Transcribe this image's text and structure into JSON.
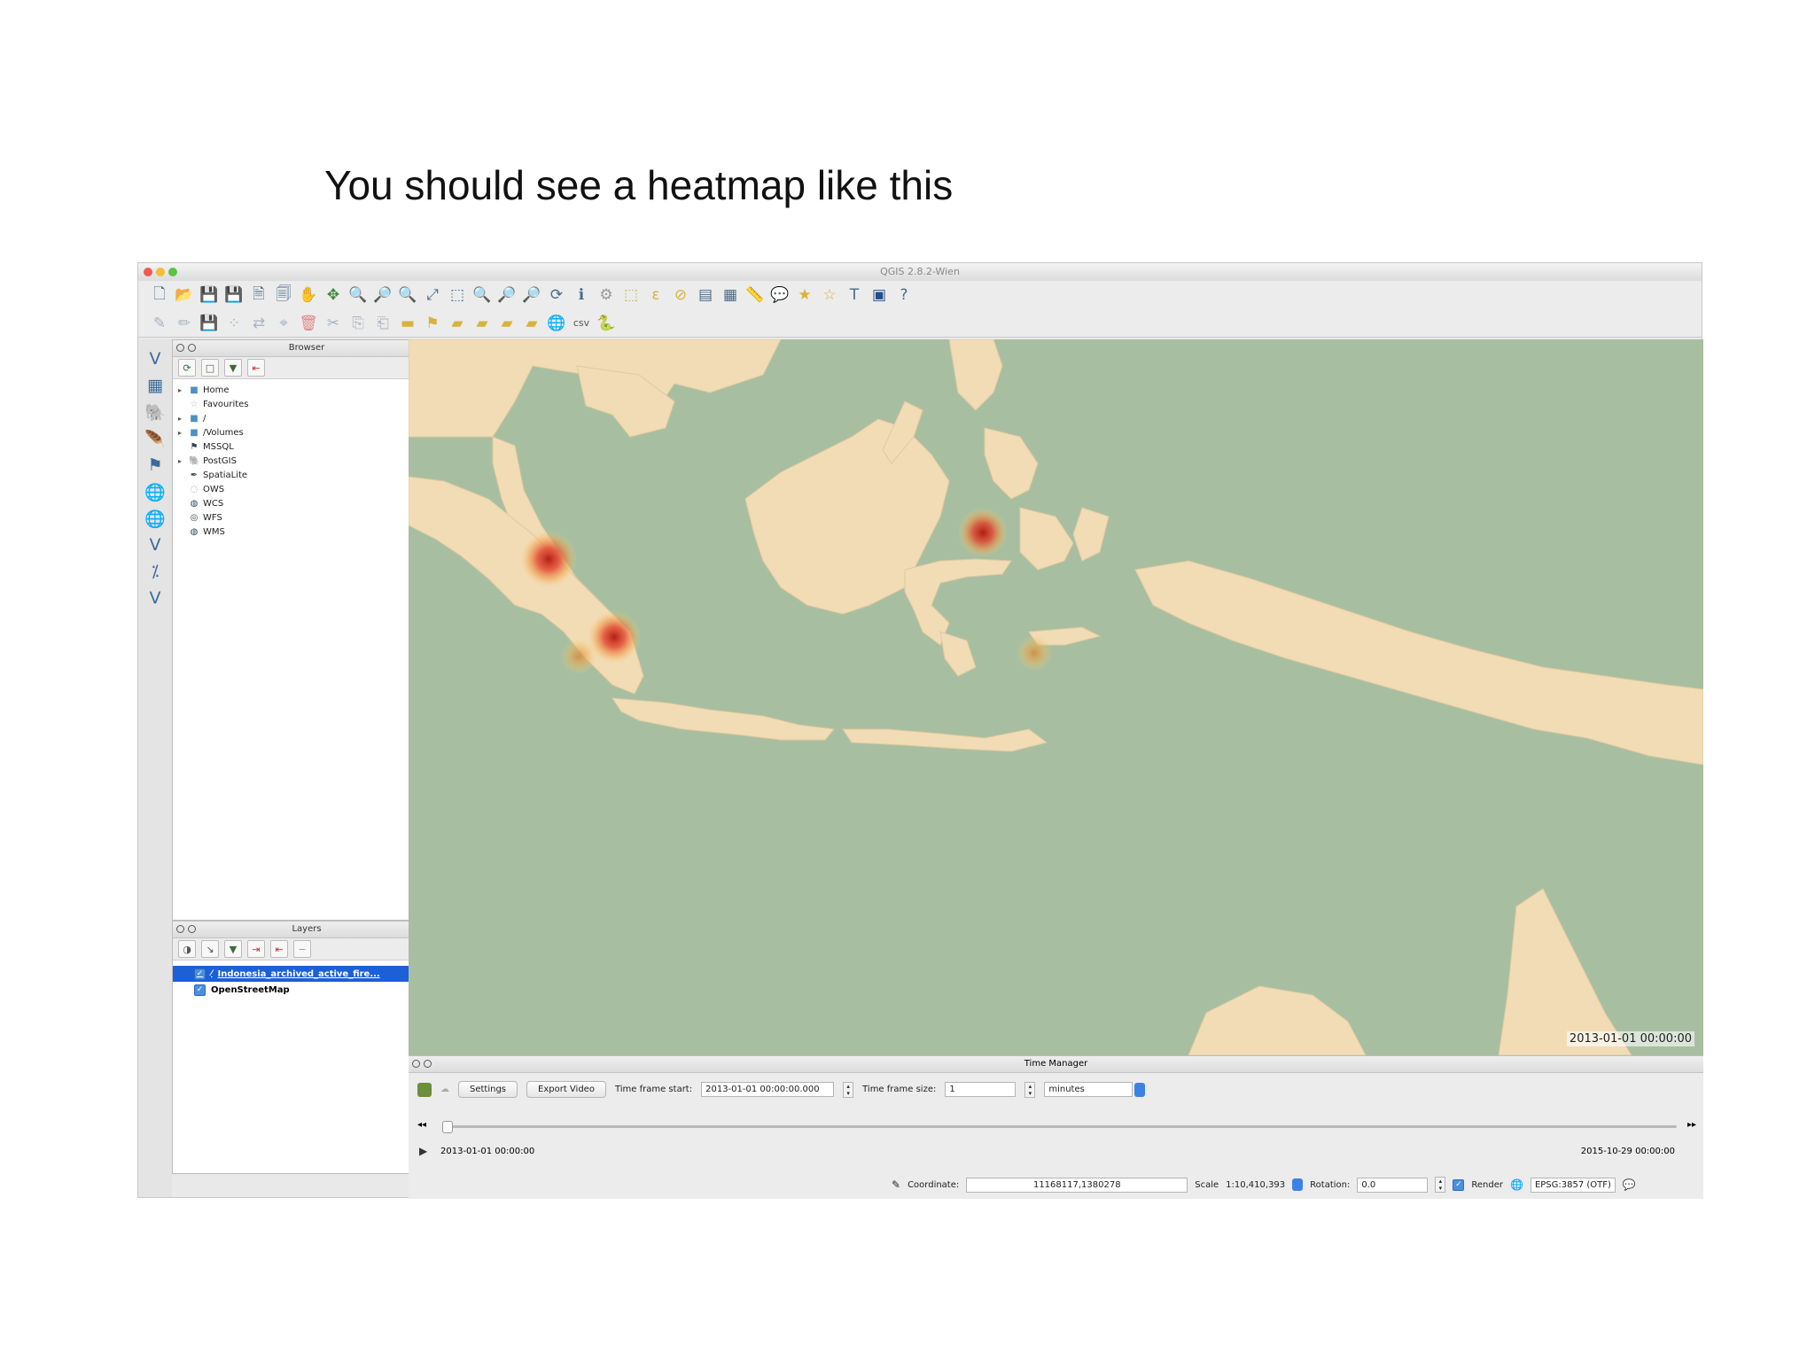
{
  "slide": {
    "title": "You should see a heatmap like this"
  },
  "window": {
    "title": "QGIS 2.8.2-Wien"
  },
  "browser": {
    "title": "Browser",
    "items": [
      {
        "label": "Home",
        "expandable": true,
        "icon": "folder-icon"
      },
      {
        "label": "Favourites",
        "expandable": false,
        "icon": "star-icon"
      },
      {
        "label": "/",
        "expandable": true,
        "icon": "folder-icon"
      },
      {
        "label": "/Volumes",
        "expandable": true,
        "icon": "folder-icon"
      },
      {
        "label": "MSSQL",
        "expandable": false,
        "icon": "mssql-icon"
      },
      {
        "label": "PostGIS",
        "expandable": true,
        "icon": "postgis-icon"
      },
      {
        "label": "SpatiaLite",
        "expandable": false,
        "icon": "spatialite-icon"
      },
      {
        "label": "OWS",
        "expandable": false,
        "icon": "ows-icon"
      },
      {
        "label": "WCS",
        "expandable": false,
        "icon": "wcs-icon"
      },
      {
        "label": "WFS",
        "expandable": false,
        "icon": "wfs-icon"
      },
      {
        "label": "WMS",
        "expandable": false,
        "icon": "wms-icon"
      }
    ]
  },
  "layers": {
    "title": "Layers",
    "items": [
      {
        "label": "Indonesia_archived_active_fire...",
        "checked": true,
        "selected": true
      },
      {
        "label": "OpenStreetMap",
        "checked": true,
        "selected": false
      }
    ]
  },
  "map": {
    "timestamp": "2013-01-01 00:00:00"
  },
  "time_manager": {
    "title": "Time Manager",
    "settings_label": "Settings",
    "export_label": "Export Video",
    "start_label": "Time frame start:",
    "start_value": "2013-01-01 00:00:00.000",
    "size_label": "Time frame size:",
    "size_value": "1",
    "unit_value": "minutes",
    "start_date": "2013-01-01 00:00:00",
    "end_date": "2015-10-29 00:00:00",
    "slider_position": 0
  },
  "status": {
    "coordinate_label": "Coordinate:",
    "coordinate_value": "11168117,1380278",
    "scale_label": "Scale",
    "scale_value": "1:10,410,393",
    "rotation_label": "Rotation:",
    "rotation_value": "0.0",
    "render_label": "Render",
    "crs_label": "EPSG:3857 (OTF)"
  },
  "colors": {
    "sea": "#a7bfa0",
    "land": "#f1dcb6",
    "selection": "#1c5fd6",
    "heat_core": "#c8281c"
  }
}
